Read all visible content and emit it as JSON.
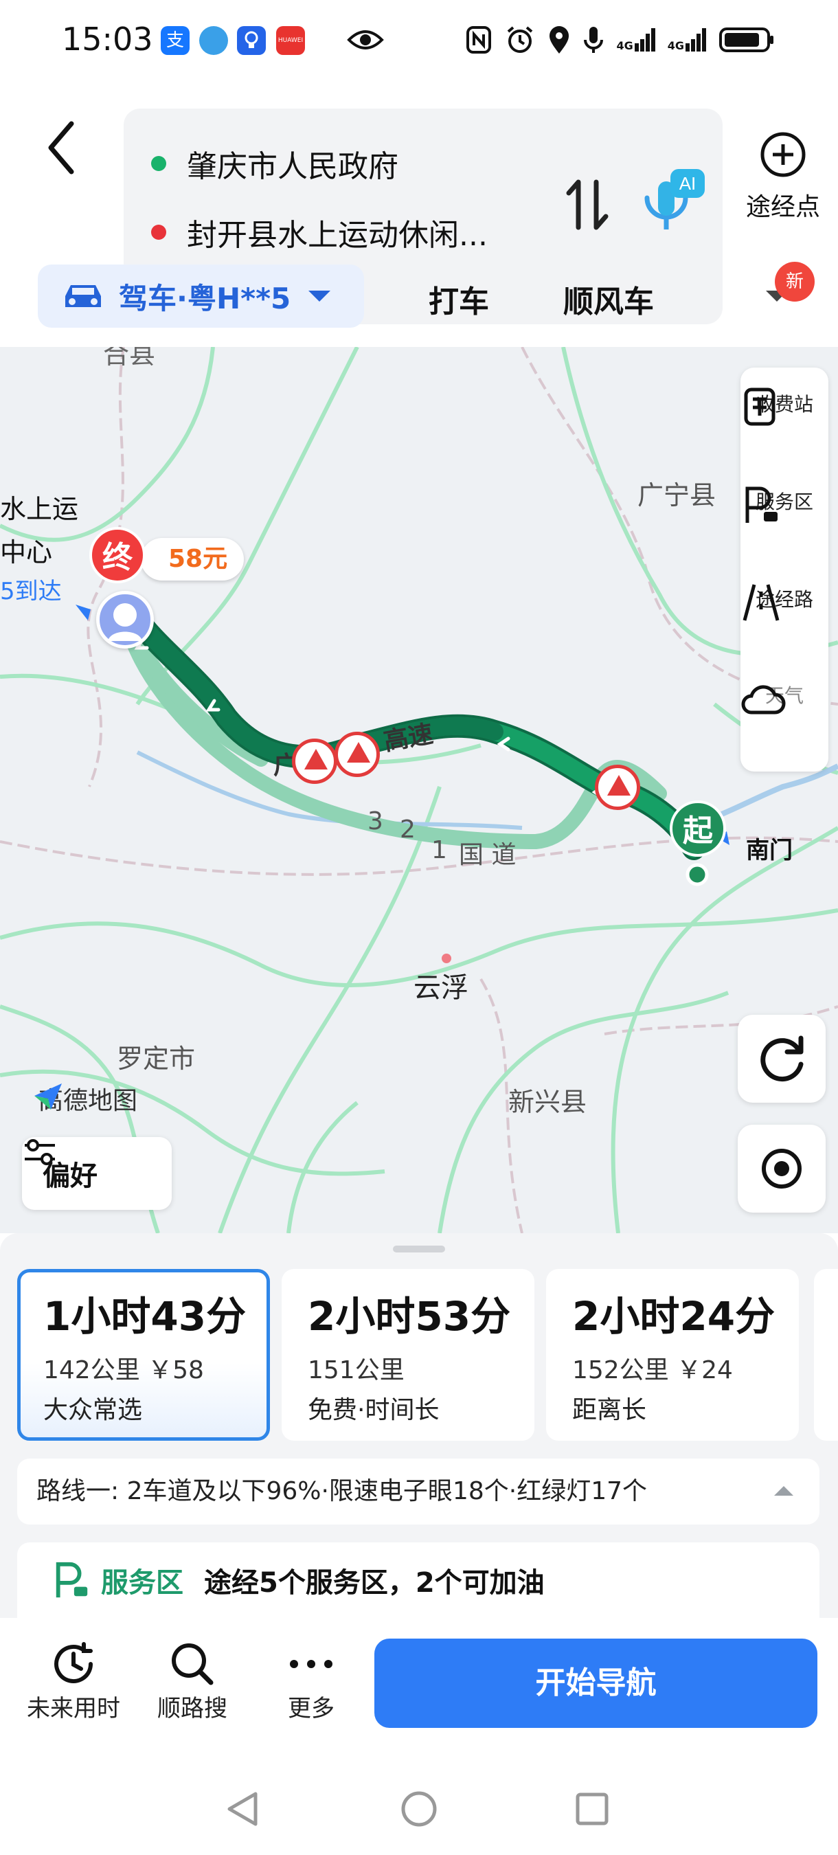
{
  "status_bar": {
    "time": "15:03",
    "app_icons": [
      "alipay-icon",
      "browser-icon",
      "bulb-icon",
      "huawei-icon"
    ],
    "huawei_label": "HUAWEI",
    "alipay_label": "支",
    "network_1": "4G",
    "network_2": "4G"
  },
  "header": {
    "origin": "肇庆市人民政府",
    "destination": "封开县水上运动休闲...",
    "waypoint_label": "途经点",
    "ai_label": "AI"
  },
  "tabs": {
    "drive": "驾车·粤H**5",
    "taxi": "打车",
    "carpool": "顺风车",
    "new_badge": "新"
  },
  "map": {
    "labels": {
      "top_partial": "合县",
      "dest_name_1": "水上运",
      "dest_name_2": "中心",
      "arrival": "5到达",
      "guangning": "广宁县",
      "gaosu": "高速",
      "guo": "广",
      "guodao": "国 道",
      "num_3": "3",
      "num_2": "2",
      "num_1": "1",
      "nanmen": "南门",
      "yunfu": "云浮",
      "luoding": "罗定市",
      "xinxing": "新兴县",
      "brand": "高德地图"
    },
    "end_pin": "终",
    "start_pin": "起",
    "cost": "58元",
    "tools": [
      {
        "label": "收费站",
        "icon": "toll-station-icon"
      },
      {
        "label": "服务区",
        "icon": "service-area-icon"
      },
      {
        "label": "途经路",
        "icon": "via-road-icon"
      },
      {
        "label": "天气",
        "icon": "weather-icon"
      }
    ],
    "preference_label": "偏好",
    "colors": {
      "route_main": "#15905d",
      "route_alt": "#8fd3b4",
      "road": "#9fe3bd"
    }
  },
  "routes": [
    {
      "time": "1小时43分",
      "detail": "142公里 ￥58",
      "tag": "大众常选",
      "selected": true
    },
    {
      "time": "2小时53分",
      "detail": "151公里",
      "tag": "免费·时间长",
      "selected": false
    },
    {
      "time": "2小时24分",
      "detail": "152公里 ￥24",
      "tag": "距离长",
      "selected": false
    }
  ],
  "route_info": "路线一:  2车道及以下96%·限速电子眼18个·红绿灯17个",
  "service": {
    "label": "服务区",
    "text": "途经5个服务区，2个可加油"
  },
  "bottom_bar": {
    "future_time": "未来用时",
    "along_search": "顺路搜",
    "more": "更多",
    "start_nav": "开始导航"
  }
}
